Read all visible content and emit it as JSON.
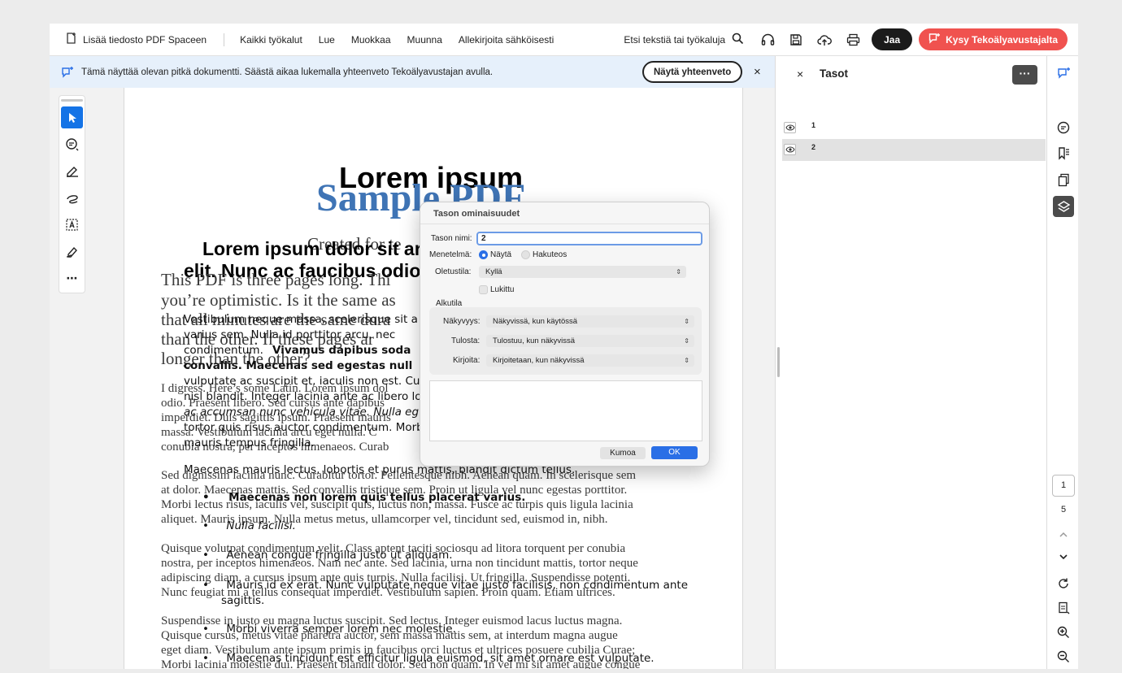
{
  "toolbar": {
    "add_file_label": "Lisää tiedosto PDF Spaceen",
    "menu": [
      "Kaikki työkalut",
      "Lue",
      "Muokkaa",
      "Muunna",
      "Allekirjoita sähköisesti"
    ],
    "search_label": "Etsi tekstiä tai työkaluja",
    "share_label": "Jaa",
    "ai_label": "Kysy Tekoälyavustajalta"
  },
  "banner": {
    "text": "Tämä näyttää olevan pitkä dokumentti. Säästä aikaa lukemalla yhteenveto Tekoälyavustajan avulla.",
    "button": "Näytä yhteenveto",
    "close": "×"
  },
  "tool_rail": {
    "more": "⋯"
  },
  "document": {
    "title": "Lorem ipsum",
    "subtitle": "Sample PDF",
    "created": "Created for te",
    "heading_line1": "Lorem ipsum dolor sit ar",
    "heading_line2": "elit. Nunc ac faucibus odio",
    "serif_lines": [
      "This PDF is three pages long. Thi",
      "you’re optimistic. Is it the same as",
      "that all minutes are the same dura",
      "than the other. If these pages ar",
      "longer than the other?",
      "I digress. Here’s some Latin. Lorem ipsum dol",
      "odio. Praesent libero. Sed cursus ante dapibus",
      "imperdiet. Duis sagittis ipsum. Praesent mauris",
      "massa. Vestibulum lacinia arcu eget nulla. C",
      "conubia nostra, per inceptos himenaeos. Curab",
      "Sed dignissim lacinia nunc. Curabitur tortor. Pellentesque nibh. Aenean quam. In scelerisque sem",
      "at dolor. Maecenas mattis. Sed convallis tristique sem. Proin ut ligula vel nunc egestas porttitor.",
      "Morbi lectus risus, iaculis vel, suscipit quis, luctus non, massa. Fusce ac turpis quis ligula lacinia",
      "aliquet. Mauris ipsum. Nulla metus metus, ullamcorper vel, tincidunt sed, euismod in, nibh.",
      "Quisque volutpat condimentum velit. Class aptent taciti sociosqu ad litora torquent per conubia",
      "nostra, per inceptos himenaeos. Nam nec ante. Sed lacinia, urna non tincidunt mattis, tortor neque",
      "adipiscing diam, a cursus ipsum ante quis turpis. Nulla facilisi. Ut fringilla. Suspendisse potenti.",
      "Nunc feugiat mi a tellus consequat imperdiet. Vestibulum sapien. Proin quam. Etiam ultrices.",
      "Suspendisse in justo eu magna luctus suscipit. Sed lectus. Integer euismod lacus luctus magna.",
      "Quisque cursus, metus vitae pharetra auctor, sem massa mattis sem, at interdum magna augue",
      "eget diam. Vestibulum ante ipsum primis in faucibus orci luctus et ultrices posuere cubilia Curae;",
      "Morbi lacinia molestie dui. Praesent blandit dolor. Sed non quam. In vel mi sit amet augue congue"
    ],
    "sans_lines": [
      "Vestibulum neque massa, scelerisque sit a",
      "varius sem. Nulla id porttitor arcu, nec",
      "condimentum.",
      "Vivamus dapibus soda",
      "convallis. Maecenas sed egestas null",
      "vulputate ac suscipit et, iaculis non est. Cu",
      "nisl blandit. Integer lacinia ante ac libero lo",
      "ac accumsan nunc vehicula vitae. Nulla eg",
      "tortor quis risus auctor condimentum. Morb",
      "mauris tempus fringilla.",
      "Maecenas mauris lectus, lobortis et purus mattis, blandit dictum tellus."
    ],
    "bullets": [
      "Maecenas non lorem quis tellus placerat varius.",
      "Nulla facilisi.",
      "Aenean congue fringilla justo ut aliquam.",
      "Mauris id ex erat. Nunc vulputate neque vitae justo facilisis, non condimentum ante",
      "sagittis.",
      "Morbi viverra semper lorem nec molestie.",
      "Maecenas tincidunt est efficitur ligula euismod, sit amet ornare est vulputate."
    ]
  },
  "dialog": {
    "title": "Tason ominaisuudet",
    "name_label": "Tason nimi:",
    "name_value": "2",
    "method_label": "Menetelmä:",
    "method_options": [
      "Näytä",
      "Hakuteos"
    ],
    "default_state_label": "Oletustila:",
    "default_state_value": "Kyllä",
    "locked_label": "Lukittu",
    "initial_state_label": "Alkutila",
    "visibility_label": "Näkyvyys:",
    "visibility_value": "Näkyvissä, kun käytössä",
    "print_label": "Tulosta:",
    "print_value": "Tulostuu, kun näkyvissä",
    "export_label": "Kirjoita:",
    "export_value": "Kirjoitetaan, kun näkyvissä",
    "cancel": "Kumoa",
    "ok": "OK"
  },
  "layers_panel": {
    "title": "Tasot",
    "close": "×",
    "more": "···",
    "layers": [
      "1",
      "2"
    ]
  },
  "right_rail": {
    "current_page": "1",
    "total_pages": "5"
  }
}
